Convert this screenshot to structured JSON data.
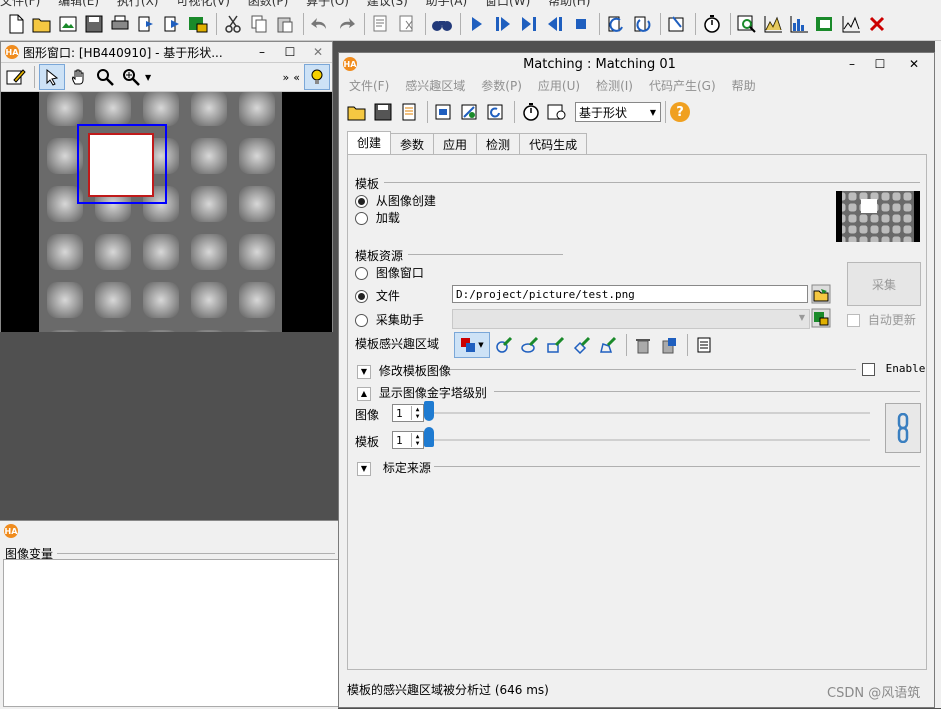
{
  "main_menu": [
    "文件(F)",
    "编辑(E)",
    "执行(X)",
    "可视化(V)",
    "函数(P)",
    "算子(O)",
    "建议(S)",
    "助手(A)",
    "窗口(W)",
    "帮助(H)"
  ],
  "graphics_window": {
    "title": "图形窗口: [HB440910] - 基于形状...",
    "minimize": "–",
    "maximize": "☐",
    "close": "✕"
  },
  "variables_pane": {
    "title": "图像变量"
  },
  "dialog": {
    "title": "Matching : Matching 01",
    "minimize": "–",
    "maximize": "☐",
    "close": "✕",
    "menu": [
      "文件(F)",
      "感兴趣区域",
      "参数(P)",
      "应用(U)",
      "检测(I)",
      "代码产生(G)",
      "帮助"
    ],
    "method_select": "基于形状",
    "tabs": [
      "创建",
      "参数",
      "应用",
      "检测",
      "代码生成"
    ],
    "active_tab": 0,
    "template_group": "模板",
    "opt_create_from_image": "从图像创建",
    "opt_load": "加载",
    "source_group": "模板资源",
    "opt_image_window": "图像窗口",
    "opt_file": "文件",
    "file_path": "D:/project/picture/test.png",
    "opt_acq_assistant": "采集助手",
    "acquire_button": "采集",
    "auto_update": "自动更新",
    "roi_label": "模板感兴趣区域",
    "modify_image": "修改模板图像",
    "enable_label": "Enable",
    "pyramid_group": "显示图像金字塔级别",
    "pyramid_image_label": "图像",
    "pyramid_image_value": "1",
    "pyramid_model_label": "模板",
    "pyramid_model_value": "1",
    "calibration_group": "标定来源",
    "status": "模板的感兴趣区域被分析过 (646 ms)"
  },
  "watermark": "CSDN @风语筑",
  "colors": {
    "accent_blue": "#1f7bd1",
    "ha_orange": "#f08c1e",
    "roi_blue": "#0000ff",
    "help_orange": "#f0a020"
  }
}
